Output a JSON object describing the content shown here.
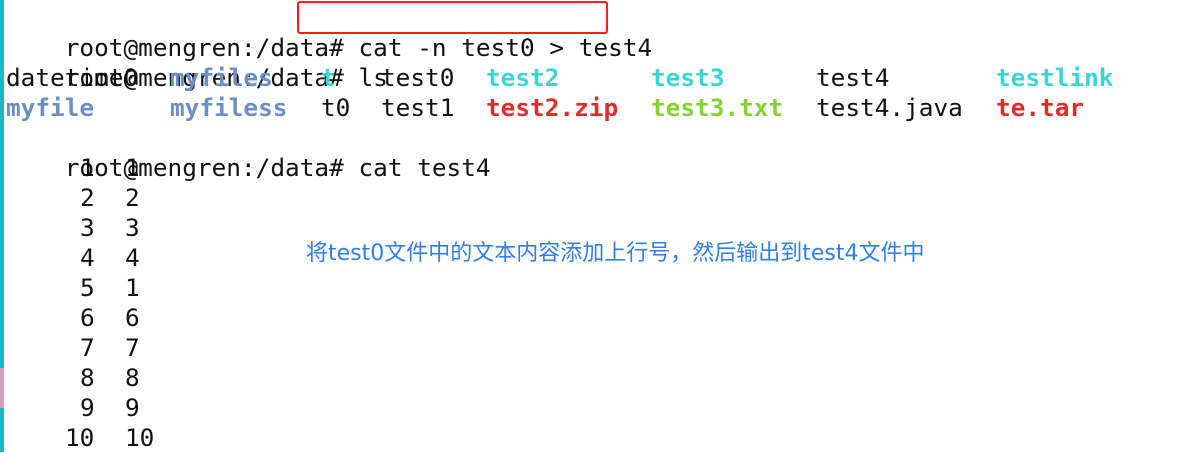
{
  "terminal": {
    "prompt": "root@mengren:/data#",
    "commands": {
      "first": "cat -n test0 > test4",
      "second": "ls",
      "third": "cat test4"
    },
    "ls_output": [
      {
        "name": "datetime0",
        "style": "plain"
      },
      {
        "name": "myfiles",
        "style": "blue"
      },
      {
        "name": "t",
        "style": "cyan"
      },
      {
        "name": "test0",
        "style": "plain"
      },
      {
        "name": "test2",
        "style": "cyan"
      },
      {
        "name": "test3",
        "style": "cyan"
      },
      {
        "name": "test4",
        "style": "plain"
      },
      {
        "name": "testlink",
        "style": "cyan"
      },
      {
        "name": "myfile",
        "style": "blue"
      },
      {
        "name": "myfiless",
        "style": "blue"
      },
      {
        "name": "t0",
        "style": "plain"
      },
      {
        "name": "test1",
        "style": "plain"
      },
      {
        "name": "test2.zip",
        "style": "red"
      },
      {
        "name": "test3.txt",
        "style": "green"
      },
      {
        "name": "test4.java",
        "style": "plain"
      },
      {
        "name": "te.tar",
        "style": "red"
      }
    ],
    "cat_output": [
      {
        "num": "1",
        "text": "1"
      },
      {
        "num": "2",
        "text": "2"
      },
      {
        "num": "3",
        "text": "3"
      },
      {
        "num": "4",
        "text": "4"
      },
      {
        "num": "5",
        "text": "1"
      },
      {
        "num": "6",
        "text": "6"
      },
      {
        "num": "7",
        "text": "7"
      },
      {
        "num": "8",
        "text": "8"
      },
      {
        "num": "9",
        "text": "9"
      },
      {
        "num": "10",
        "text": "10"
      }
    ]
  },
  "annotation": {
    "text": "将test0文件中的文本内容添加上行号，然后输出到test4文件中",
    "color": "#2f7fe6",
    "box_color": "#ff1c1c"
  },
  "colors": {
    "directory": "#6a8fc2",
    "symlink": "#3ad6d6",
    "archive": "#e52a2a",
    "executable": "#86d233",
    "text": "#111111"
  }
}
